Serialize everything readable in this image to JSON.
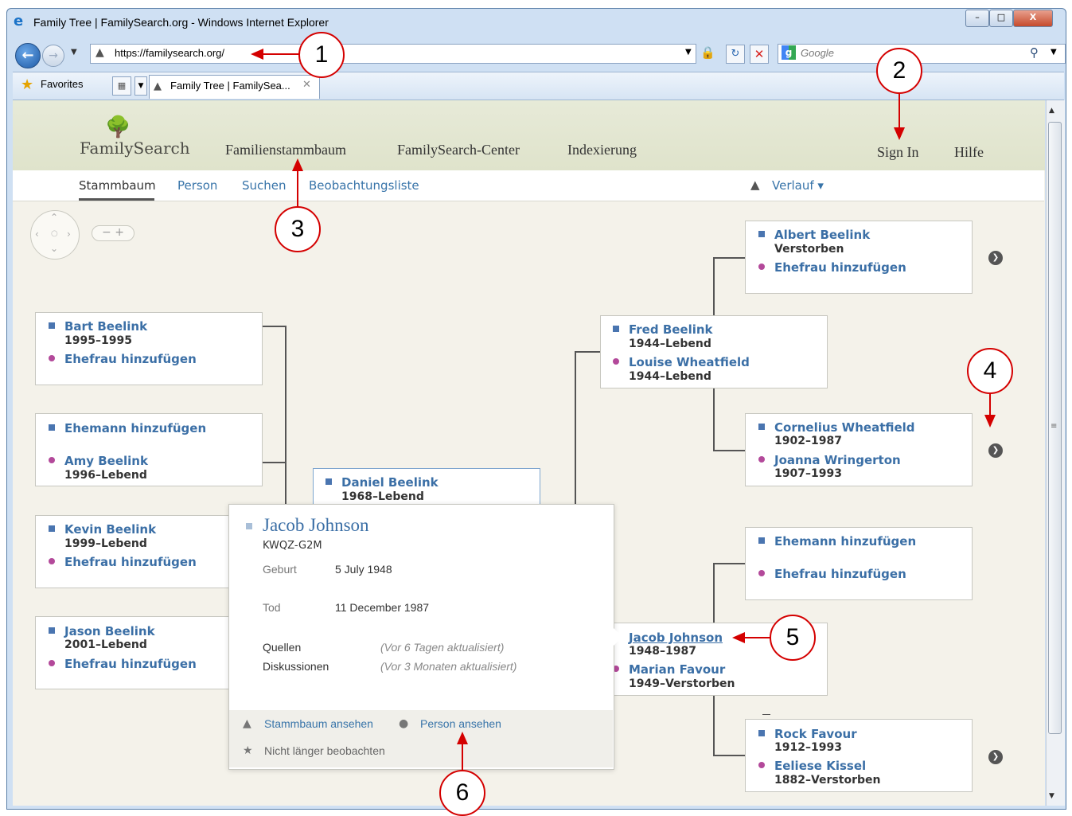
{
  "window": {
    "title": "Family Tree | FamilySearch.org - Windows Internet Explorer",
    "min_label": "–",
    "max_label": "□",
    "close_label": "X"
  },
  "nav": {
    "address": "https://familysearch.org/",
    "search_placeholder": "Google"
  },
  "favorites": {
    "label": "Favorites",
    "tab_title": "Family Tree | FamilySea..."
  },
  "site": {
    "logo": "FamilySearch",
    "topnav": [
      "Familienstammbaum",
      "FamilySearch-Center",
      "Indexierung"
    ],
    "sign_in": "Sign In",
    "help": "Hilfe",
    "subnav": [
      "Stammbaum",
      "Person",
      "Suchen",
      "Beobachtungsliste"
    ],
    "history": "Verlauf ▾",
    "zoom": "−  +"
  },
  "cards": {
    "bart": {
      "name": "Bart Beelink",
      "dates": "1995–1995",
      "spouse": "Ehefrau hinzufügen"
    },
    "amy": {
      "husband": "Ehemann hinzufügen",
      "name": "Amy Beelink",
      "dates": "1996–Lebend"
    },
    "kevin": {
      "name": "Kevin Beelink",
      "dates": "1999–Lebend",
      "spouse": "Ehefrau hinzufügen"
    },
    "jason": {
      "name": "Jason Beelink",
      "dates": "2001–Lebend",
      "spouse": "Ehefrau hinzufügen"
    },
    "daniel": {
      "name": "Daniel Beelink",
      "dates": "1968–Lebend"
    },
    "fred": {
      "name": "Fred Beelink",
      "dates": "1944–Lebend",
      "spouse": "Louise Wheatfield",
      "spouse_dates": "1944–Lebend"
    },
    "albert": {
      "name": "Albert Beelink",
      "dates": "Verstorben",
      "spouse": "Ehefrau hinzufügen"
    },
    "cornelius": {
      "name": "Cornelius Wheatfield",
      "dates": "1902–1987",
      "spouse": "Joanna Wringerton",
      "spouse_dates": "1907–1993"
    },
    "empty": {
      "husband": "Ehemann hinzufügen",
      "wife": "Ehefrau hinzufügen"
    },
    "jacob": {
      "name": "Jacob Johnson",
      "dates": "1948–1987",
      "spouse": "Marian Favour",
      "spouse_dates": "1949–Verstorben"
    },
    "rock": {
      "name": "Rock Favour",
      "dates": "1912–1993",
      "spouse": "Eeliese Kissel",
      "spouse_dates": "1882–Verstorben"
    }
  },
  "popup": {
    "name": "Jacob Johnson",
    "id": "KWQZ-G2M",
    "birth_label": "Geburt",
    "birth": "5 July 1948",
    "death_label": "Tod",
    "death": "11 December 1987",
    "sources_label": "Quellen",
    "sources_note": "(Vor 6 Tagen aktualisiert)",
    "discussions_label": "Diskussionen",
    "discussions_note": "(Vor 3 Monaten aktualisiert)",
    "view_tree": "Stammbaum ansehen",
    "view_person": "Person ansehen",
    "unwatch": "Nicht länger beobachten"
  },
  "callouts": [
    "1",
    "2",
    "3",
    "4",
    "5",
    "6"
  ],
  "colors": {
    "link": "#3b6fa6",
    "female": "#b3499a",
    "annotation": "#d40000"
  }
}
